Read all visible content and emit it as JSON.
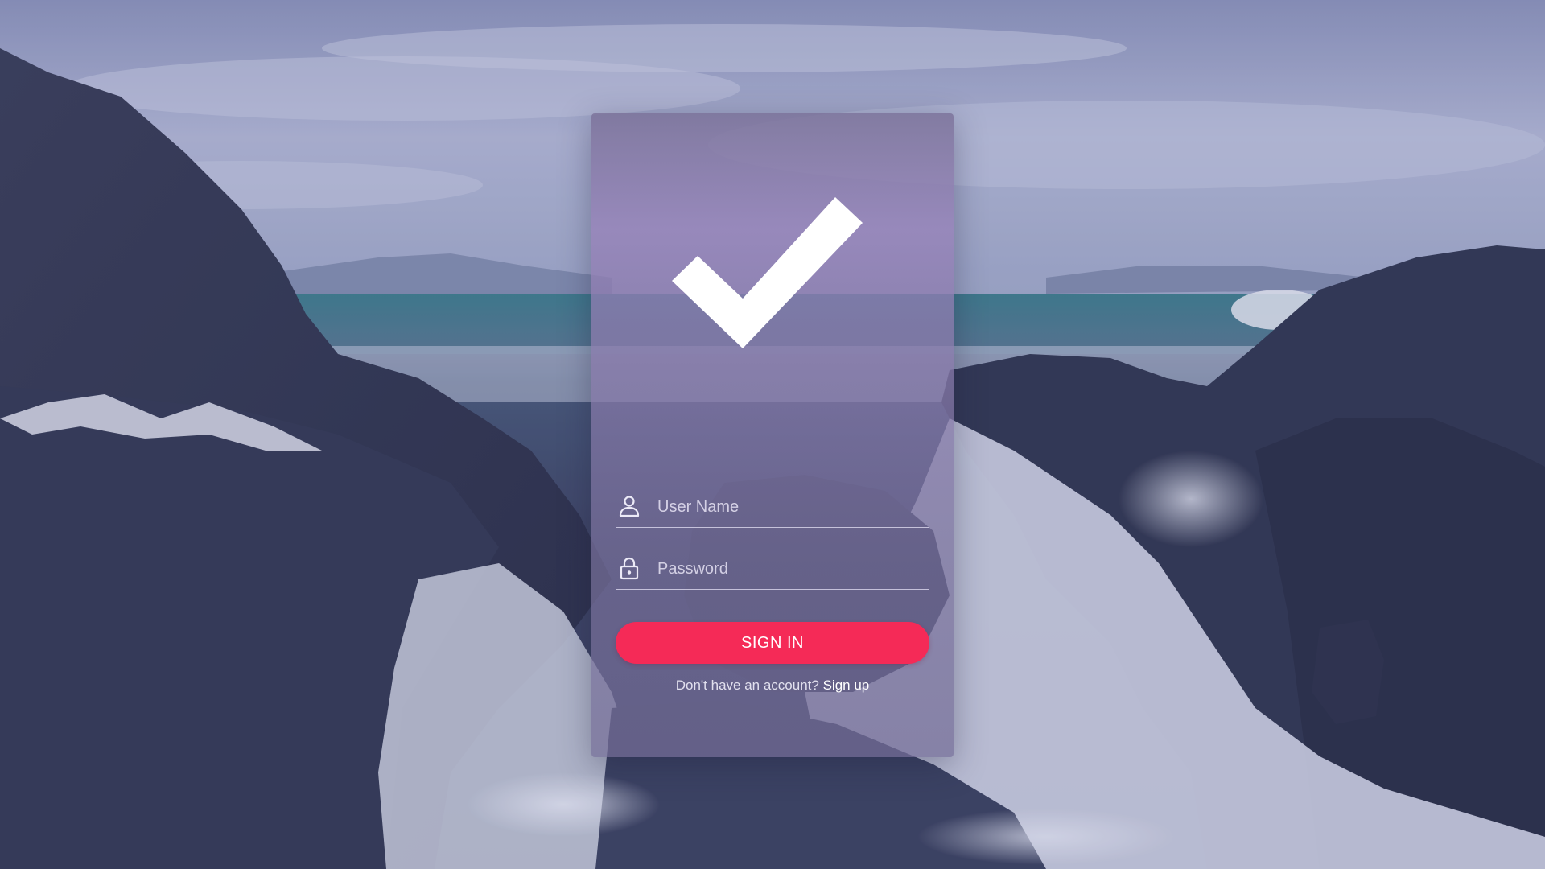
{
  "login": {
    "logo_icon": "checkmark-icon",
    "username": {
      "icon": "user-icon",
      "placeholder": "User Name",
      "value": ""
    },
    "password": {
      "icon": "lock-icon",
      "placeholder": "Password",
      "value": ""
    },
    "signin_label": "SIGN IN",
    "signup_prompt": "Don't have an account?",
    "signup_link": "Sign up"
  },
  "colors": {
    "accent": "#f52a57",
    "card_tint": "#8a7aac",
    "text": "#ffffff"
  }
}
